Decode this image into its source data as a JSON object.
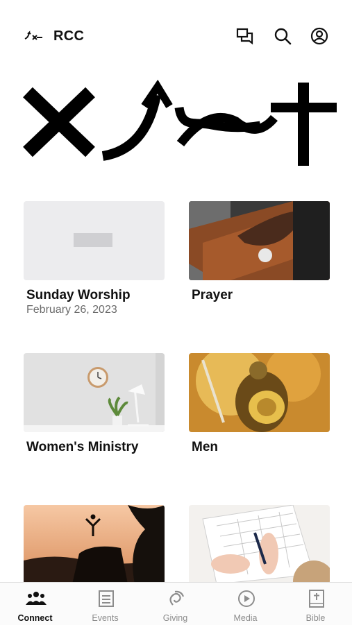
{
  "header": {
    "app_name": "RCC",
    "icons": [
      "logo-mark-icon",
      "chat-icon",
      "search-icon",
      "profile-icon"
    ]
  },
  "cards": [
    {
      "title": "Sunday Worship",
      "subtitle": "February 26, 2023",
      "image": "placeholder"
    },
    {
      "title": "Prayer",
      "subtitle": "",
      "image": "hands-on-bible"
    },
    {
      "title": "Women's Ministry",
      "subtitle": "",
      "image": "clock-wall-plant"
    },
    {
      "title": "Men",
      "subtitle": "",
      "image": "armored-knight"
    },
    {
      "title": "",
      "subtitle": "",
      "image": "silhouette-on-rock"
    },
    {
      "title": "",
      "subtitle": "",
      "image": "hands-planner"
    }
  ],
  "tabs": [
    {
      "label": "Connect",
      "icon": "people-icon",
      "active": true
    },
    {
      "label": "Events",
      "icon": "calendar-icon",
      "active": false
    },
    {
      "label": "Giving",
      "icon": "giving-icon",
      "active": false
    },
    {
      "label": "Media",
      "icon": "play-icon",
      "active": false
    },
    {
      "label": "Bible",
      "icon": "bible-icon",
      "active": false
    }
  ],
  "colors": {
    "accent": "#111111",
    "inactive": "#8c8c8c",
    "placeholder_bg": "#ececee"
  }
}
